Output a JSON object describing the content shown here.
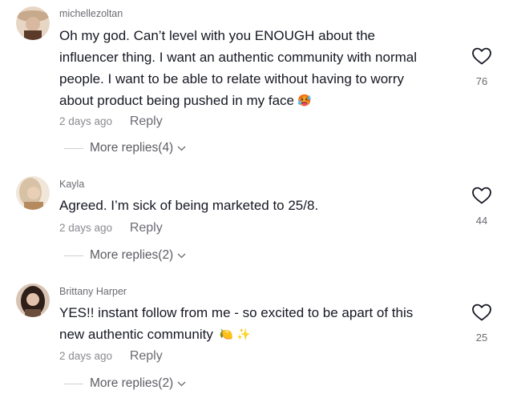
{
  "comments": [
    {
      "username": "michellezoltan",
      "lines": [
        "Oh my god. Can’t level with you ENOUGH about the",
        "influencer thing. I want an authentic community with normal",
        "people. I want to be able to relate without having to worry",
        "about product being pushed in my face"
      ],
      "emoji": "🥵",
      "date": "2 days ago",
      "reply_label": "Reply",
      "more_replies": "More replies(4)",
      "likes": "76",
      "avatar_colors": [
        "#c7a98b",
        "#5b3a2a",
        "#e8d6c4"
      ]
    },
    {
      "username": "Kayla",
      "lines": [
        "Agreed. I’m sick of being marketed to 25/8."
      ],
      "emoji": "",
      "date": "2 days ago",
      "reply_label": "Reply",
      "more_replies": "More replies(2)",
      "likes": "44",
      "avatar_colors": [
        "#d8c2a6",
        "#b58a5e",
        "#f1e6da"
      ]
    },
    {
      "username": "Brittany Harper",
      "lines": [
        "YES!! instant follow from me - so excited to be apart of this",
        "new authentic community"
      ],
      "emoji": "🍋 ✨",
      "date": "2 days ago",
      "reply_label": "Reply",
      "more_replies": "More replies(2)",
      "likes": "25",
      "avatar_colors": [
        "#6a4d3a",
        "#2e1f18",
        "#d9c4b4"
      ]
    }
  ]
}
